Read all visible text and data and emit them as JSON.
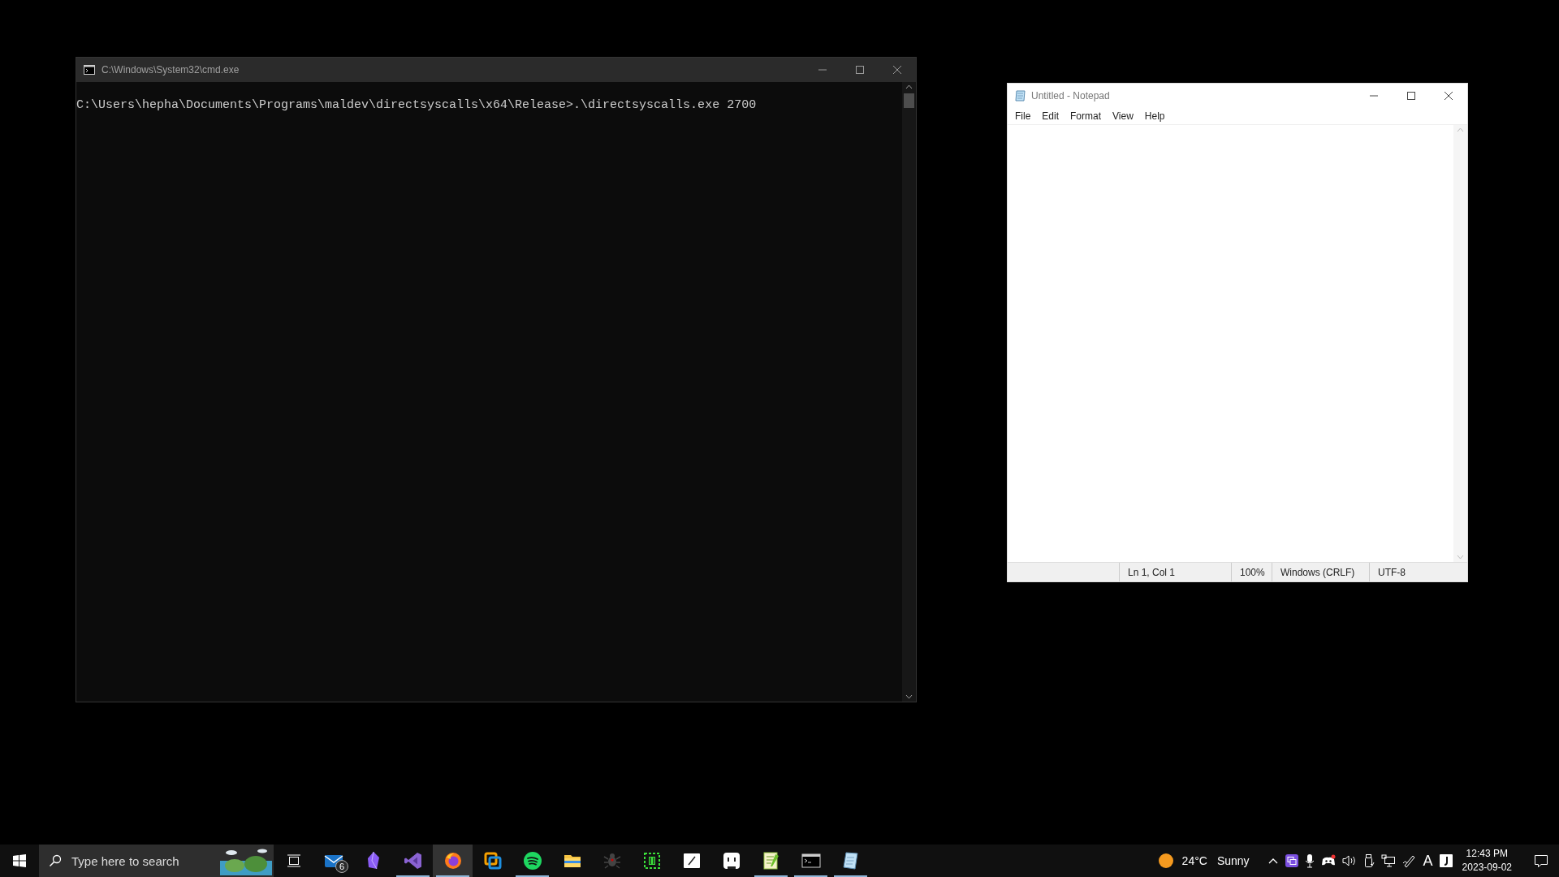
{
  "console_window": {
    "title": "C:\\Windows\\System32\\cmd.exe",
    "lines": [
      "C:\\Users\\hepha\\Documents\\Programs\\maldev\\directsyscalls\\x64\\Release>.\\directsyscalls.exe 2700"
    ]
  },
  "notepad_window": {
    "title": "Untitled - Notepad",
    "menu": [
      "File",
      "Edit",
      "Format",
      "View",
      "Help"
    ],
    "status_bar": [
      "Ln 1, Col 1",
      "100%",
      "Windows (CRLF)",
      "UTF-8"
    ]
  },
  "taskbar": {
    "search": {
      "placeholder": "Type here to search"
    },
    "apps": [
      {
        "running": false,
        "selected": false,
        "badge": "6"
      },
      {
        "running": false,
        "selected": false
      },
      {
        "running": true,
        "selected": false
      },
      {
        "running": true,
        "selected": true
      },
      {
        "running": false,
        "selected": false
      },
      {
        "running": true,
        "selected": false
      },
      {
        "running": false,
        "selected": false
      },
      {
        "running": false,
        "selected": false
      },
      {
        "running": false,
        "selected": false
      },
      {
        "running": false,
        "selected": false
      },
      {
        "running": false,
        "selected": false
      },
      {
        "running": true,
        "selected": false
      },
      {
        "running": true,
        "selected": false
      },
      {
        "running": true,
        "selected": false
      }
    ],
    "input_language": "A",
    "weather": {
      "temperature": "24°C",
      "condition": "Sunny"
    },
    "clock": {
      "time": "12:43 PM",
      "date": "2023-09-02"
    }
  }
}
